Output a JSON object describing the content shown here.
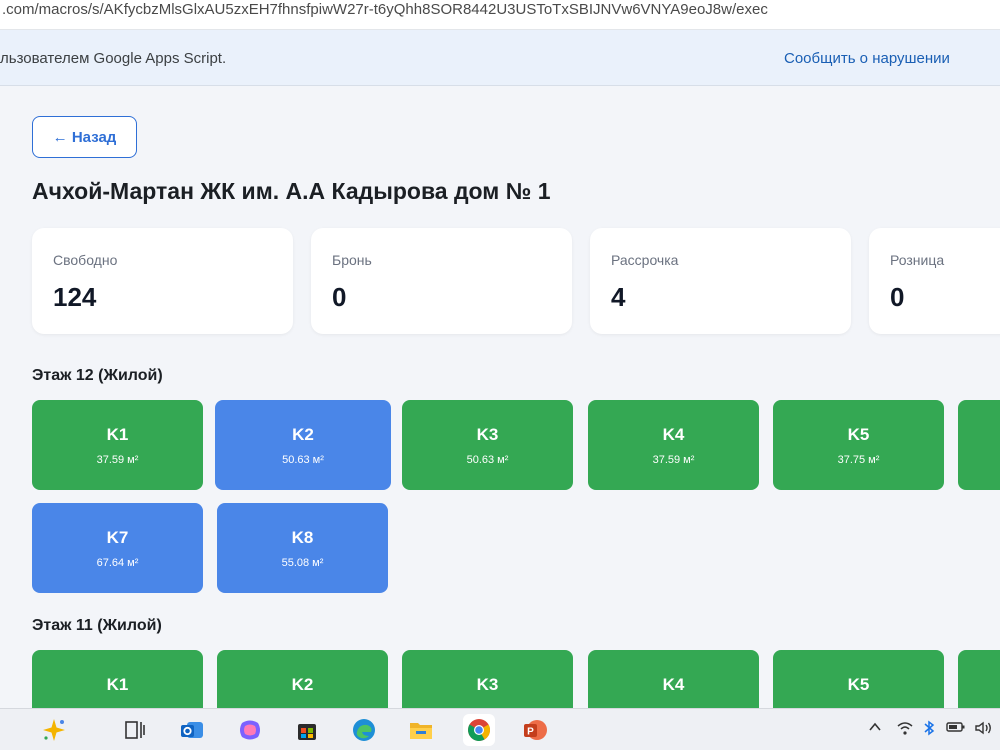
{
  "browser": {
    "url": ".com/macros/s/AKfycbzMlsGlxAU5zxEH7fhnsfpiwW27r-t6yQhh8SOR8442U3USToTxSBIJNVw6VNYA9eoJ8w/exec"
  },
  "banner": {
    "text": "льзователем Google Apps Script.",
    "report_link": "Сообщить о нарушении"
  },
  "header": {
    "back_label": "← Назад",
    "title": "Ачхой-Мартан ЖК им. А.А Кадырова дом № 1"
  },
  "stats": [
    {
      "label": "Свободно",
      "value": "124"
    },
    {
      "label": "Бронь",
      "value": "0"
    },
    {
      "label": "Рассрочка",
      "value": "4"
    },
    {
      "label": "Розница",
      "value": "0"
    }
  ],
  "colors": {
    "free": "#34a853",
    "installment": "#4a86e8",
    "accent": "#2f6fd6"
  },
  "floors": [
    {
      "title": "Этаж 12 (Жилой)",
      "apartments": [
        {
          "num": "K1",
          "area": "37.59 м²",
          "status": "free"
        },
        {
          "num": "K2",
          "area": "50.63 м²",
          "status": "installment"
        },
        {
          "num": "K3",
          "area": "50.63 м²",
          "status": "free"
        },
        {
          "num": "K4",
          "area": "37.59 м²",
          "status": "free"
        },
        {
          "num": "K5",
          "area": "37.75 м²",
          "status": "free"
        },
        {
          "num": "",
          "area": "",
          "status": "free"
        },
        {
          "num": "K7",
          "area": "67.64 м²",
          "status": "installment"
        },
        {
          "num": "K8",
          "area": "55.08 м²",
          "status": "installment"
        }
      ]
    },
    {
      "title": "Этаж 11 (Жилой)",
      "apartments": [
        {
          "num": "K1",
          "area": "",
          "status": "free"
        },
        {
          "num": "K2",
          "area": "",
          "status": "free"
        },
        {
          "num": "K3",
          "area": "",
          "status": "free"
        },
        {
          "num": "K4",
          "area": "",
          "status": "free"
        },
        {
          "num": "K5",
          "area": "",
          "status": "free"
        },
        {
          "num": "",
          "area": "",
          "status": "free"
        }
      ]
    }
  ],
  "taskbar": {
    "icons": [
      "copilot-sparkle-icon",
      "task-view-icon",
      "outlook-icon",
      "copilot-icon",
      "store-icon",
      "edge-icon",
      "file-explorer-icon",
      "chrome-icon",
      "powerpoint-icon"
    ],
    "tray": [
      "chevron-up-icon",
      "wifi-icon",
      "bluetooth-icon",
      "battery-icon",
      "volume-icon"
    ]
  }
}
